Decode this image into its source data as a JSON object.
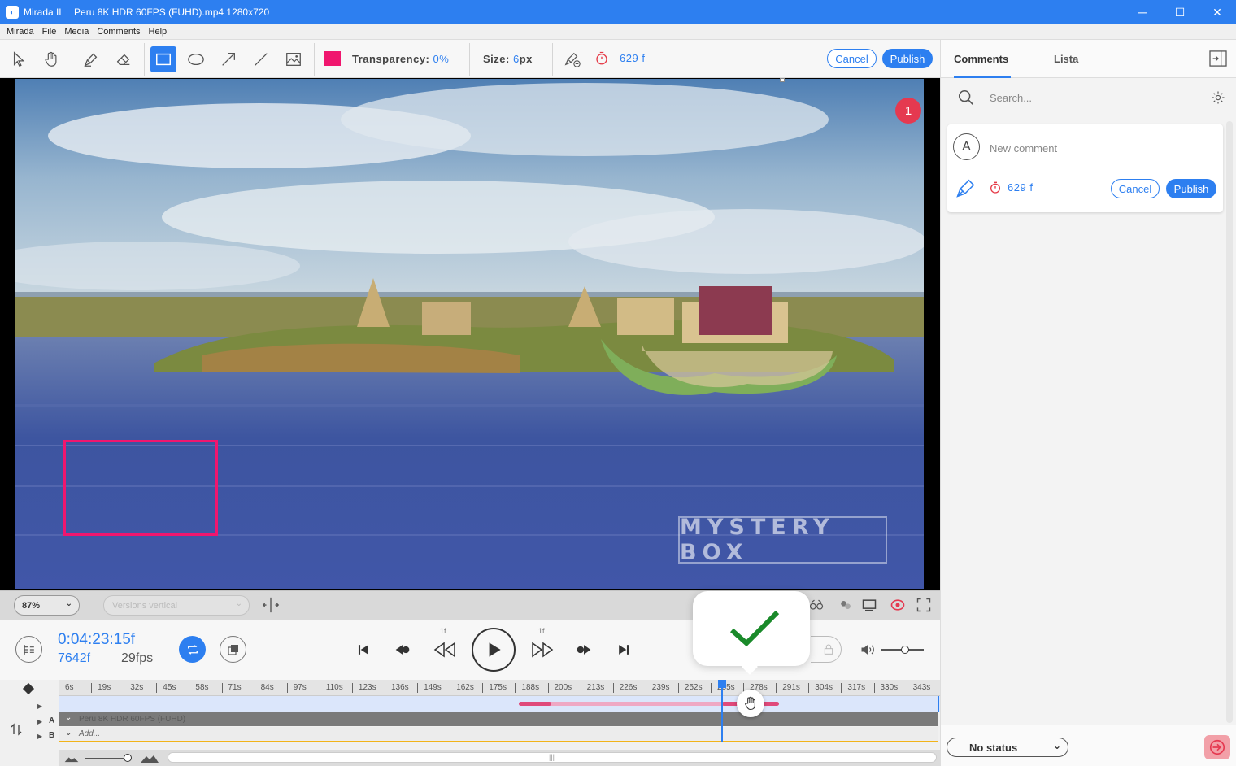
{
  "window": {
    "app_name": "Mirada IL",
    "file_title": "Peru 8K HDR 60FPS (FUHD).mp4 1280x720",
    "minimize": "─",
    "maximize": "☐",
    "close": "✕"
  },
  "menu": [
    "Mirada",
    "File",
    "Media",
    "Comments",
    "Help"
  ],
  "toolbar": {
    "transparency_label": "Transparency:",
    "transparency_value": "0%",
    "size_label": "Size:",
    "size_value": "6",
    "size_unit": "px",
    "frame_value": "629",
    "frame_unit": "f",
    "cancel_label": "Cancel",
    "publish_label": "Publish",
    "color": "#f0166e"
  },
  "panel": {
    "tabs": [
      "Comments",
      "Lista"
    ],
    "search_placeholder": "Search...",
    "avatar_letter": "A",
    "new_comment_placeholder": "New comment",
    "frame_value": "629",
    "frame_unit": "f",
    "cancel_label": "Cancel",
    "publish_label": "Publish",
    "status_label": "No status"
  },
  "video": {
    "marker_number": "1",
    "watermark": "MYSTERY BOX"
  },
  "viewer": {
    "zoom": "87%",
    "versions": "Versions vertical"
  },
  "transport": {
    "timecode": "0:04:23:15f",
    "frame": "7642f",
    "fps": "29fps",
    "step_back_label": "1f",
    "step_fwd_label": "1f"
  },
  "timeline": {
    "ticks": [
      "6s",
      "19s",
      "32s",
      "45s",
      "58s",
      "71s",
      "84s",
      "97s",
      "110s",
      "123s",
      "136s",
      "149s",
      "162s",
      "175s",
      "188s",
      "200s",
      "213s",
      "226s",
      "239s",
      "252s",
      "265s",
      "278s",
      "291s",
      "304s",
      "317s",
      "330s",
      "343s"
    ],
    "track_a_letter": "A",
    "track_b_letter": "B",
    "track_a_name": "Peru 8K HDR 60FPS (FUHD)",
    "track_b_name": "Add..."
  },
  "colors": {
    "accent": "#2d7ff0",
    "annotation": "#f0166e",
    "check": "#1a8a2a"
  }
}
